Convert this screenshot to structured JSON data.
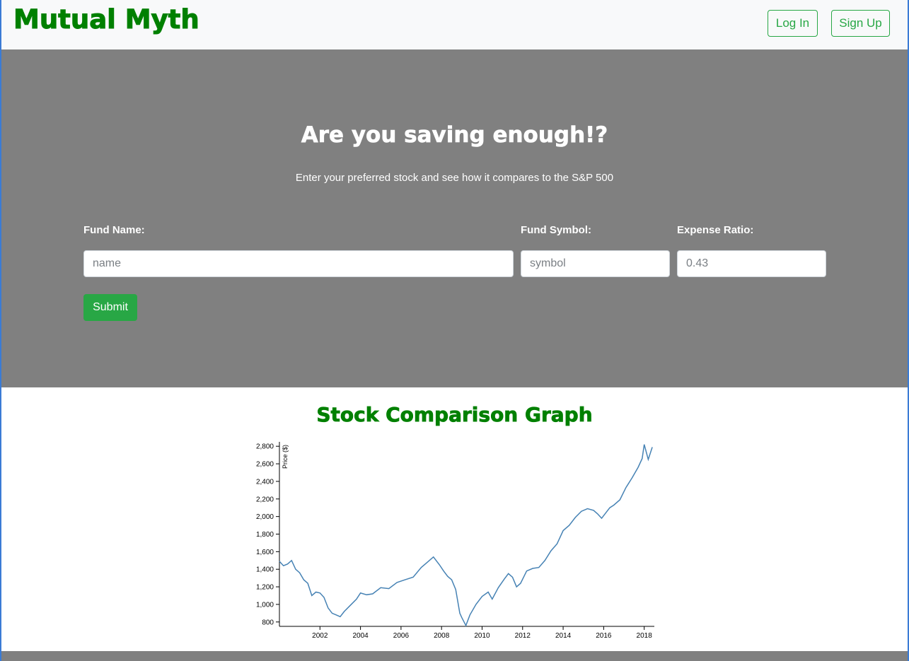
{
  "brand": "Mutual Myth",
  "nav": {
    "login": "Log In",
    "signup": "Sign Up"
  },
  "hero": {
    "title": "Are you saving enough!?",
    "subtitle": "Enter your preferred stock and see how it compares to the S&P 500"
  },
  "form": {
    "fund_name_label": "Fund Name:",
    "fund_name_placeholder": "name",
    "fund_symbol_label": "Fund Symbol:",
    "fund_symbol_placeholder": "symbol",
    "expense_ratio_label": "Expense Ratio:",
    "expense_ratio_placeholder": "0.43",
    "submit": "Submit"
  },
  "graph": {
    "title": "Stock Comparison Graph"
  },
  "colors": {
    "brand": "#008000",
    "hero_bg": "#808080",
    "accent": "#28a745",
    "line": "#4682b4"
  },
  "chart_data": {
    "type": "line",
    "ylabel": "Price ($)",
    "xlim": [
      2000.0,
      2018.5
    ],
    "ylim": [
      750,
      2850
    ],
    "yticks": [
      800,
      1000,
      1200,
      1400,
      1600,
      1800,
      2000,
      2200,
      2400,
      2600,
      2800
    ],
    "ytick_labels": [
      "800",
      "1,000",
      "1,200",
      "1,400",
      "1,600",
      "1,800",
      "2,000",
      "2,200",
      "2,400",
      "2,600",
      "2,800"
    ],
    "xticks": [
      2002,
      2004,
      2006,
      2008,
      2010,
      2012,
      2014,
      2016,
      2018
    ],
    "xtick_labels": [
      "2002",
      "2004",
      "2006",
      "2008",
      "2010",
      "2012",
      "2014",
      "2016",
      "2018"
    ],
    "series": [
      {
        "x": [
          2000.0,
          2000.2,
          2000.4,
          2000.6,
          2000.8,
          2001.0,
          2001.2,
          2001.4,
          2001.6,
          2001.8,
          2002.0,
          2002.2,
          2002.4,
          2002.6,
          2002.8,
          2003.0,
          2003.2,
          2003.5,
          2003.8,
          2004.0,
          2004.3,
          2004.6,
          2005.0,
          2005.4,
          2005.8,
          2006.2,
          2006.6,
          2007.0,
          2007.3,
          2007.6,
          2007.9,
          2008.1,
          2008.3,
          2008.5,
          2008.7,
          2008.9,
          2009.0,
          2009.2,
          2009.4,
          2009.7,
          2010.0,
          2010.3,
          2010.5,
          2010.8,
          2011.1,
          2011.3,
          2011.5,
          2011.7,
          2011.9,
          2012.2,
          2012.5,
          2012.8,
          2013.1,
          2013.4,
          2013.7,
          2014.0,
          2014.3,
          2014.6,
          2014.9,
          2015.2,
          2015.5,
          2015.7,
          2015.9,
          2016.1,
          2016.3,
          2016.5,
          2016.8,
          2017.1,
          2017.4,
          2017.7,
          2017.9,
          2018.0,
          2018.2,
          2018.4
        ],
        "y": [
          1490,
          1440,
          1460,
          1500,
          1400,
          1360,
          1280,
          1240,
          1100,
          1140,
          1130,
          1080,
          960,
          900,
          880,
          860,
          920,
          990,
          1060,
          1130,
          1110,
          1120,
          1190,
          1180,
          1250,
          1280,
          1310,
          1420,
          1480,
          1540,
          1450,
          1380,
          1320,
          1280,
          1170,
          900,
          850,
          760,
          880,
          1000,
          1090,
          1140,
          1060,
          1190,
          1290,
          1350,
          1310,
          1200,
          1240,
          1380,
          1410,
          1420,
          1500,
          1610,
          1690,
          1840,
          1900,
          1990,
          2060,
          2090,
          2070,
          2030,
          1980,
          2040,
          2100,
          2130,
          2190,
          2330,
          2440,
          2560,
          2660,
          2820,
          2650,
          2790
        ]
      }
    ]
  }
}
